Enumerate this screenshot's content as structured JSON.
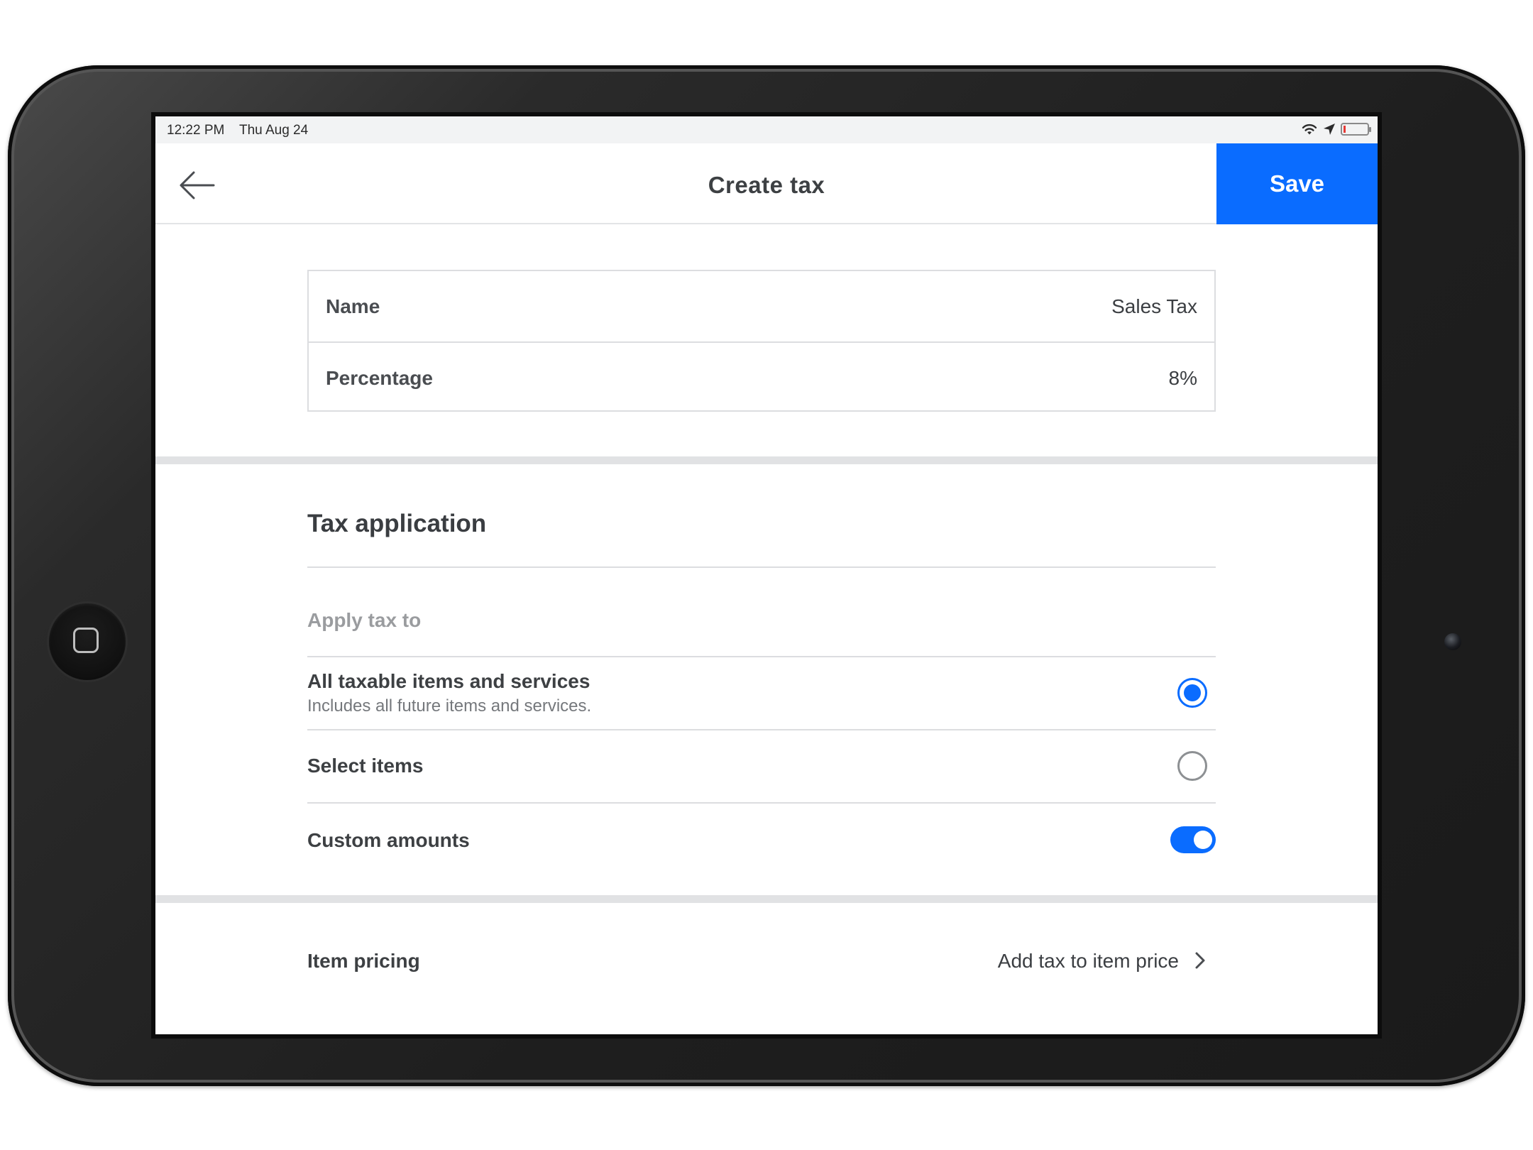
{
  "status_bar": {
    "time": "12:22 PM",
    "date": "Thu Aug 24",
    "icons": [
      "wifi-icon",
      "location-arrow-icon",
      "battery-icon"
    ],
    "battery_level": 0.05
  },
  "nav": {
    "title": "Create tax",
    "save_label": "Save",
    "back_icon": "back-arrow-icon"
  },
  "fields": [
    {
      "label": "Name",
      "value": "Sales Tax"
    },
    {
      "label": "Percentage",
      "value": "8%"
    }
  ],
  "tax_application": {
    "title": "Tax application",
    "apply_label": "Apply tax to",
    "options": [
      {
        "title": "All taxable items and services",
        "subtitle": "Includes all future items and services.",
        "selected": true
      },
      {
        "title": "Select items",
        "selected": false
      }
    ],
    "custom_amounts": {
      "label": "Custom amounts",
      "enabled": true
    }
  },
  "item_pricing": {
    "label": "Item pricing",
    "value": "Add tax to item price"
  },
  "colors": {
    "accent": "#0a6cff",
    "text_primary": "#3d4043",
    "text_muted": "#9a9c9f",
    "divider": "#e1e2e4"
  }
}
